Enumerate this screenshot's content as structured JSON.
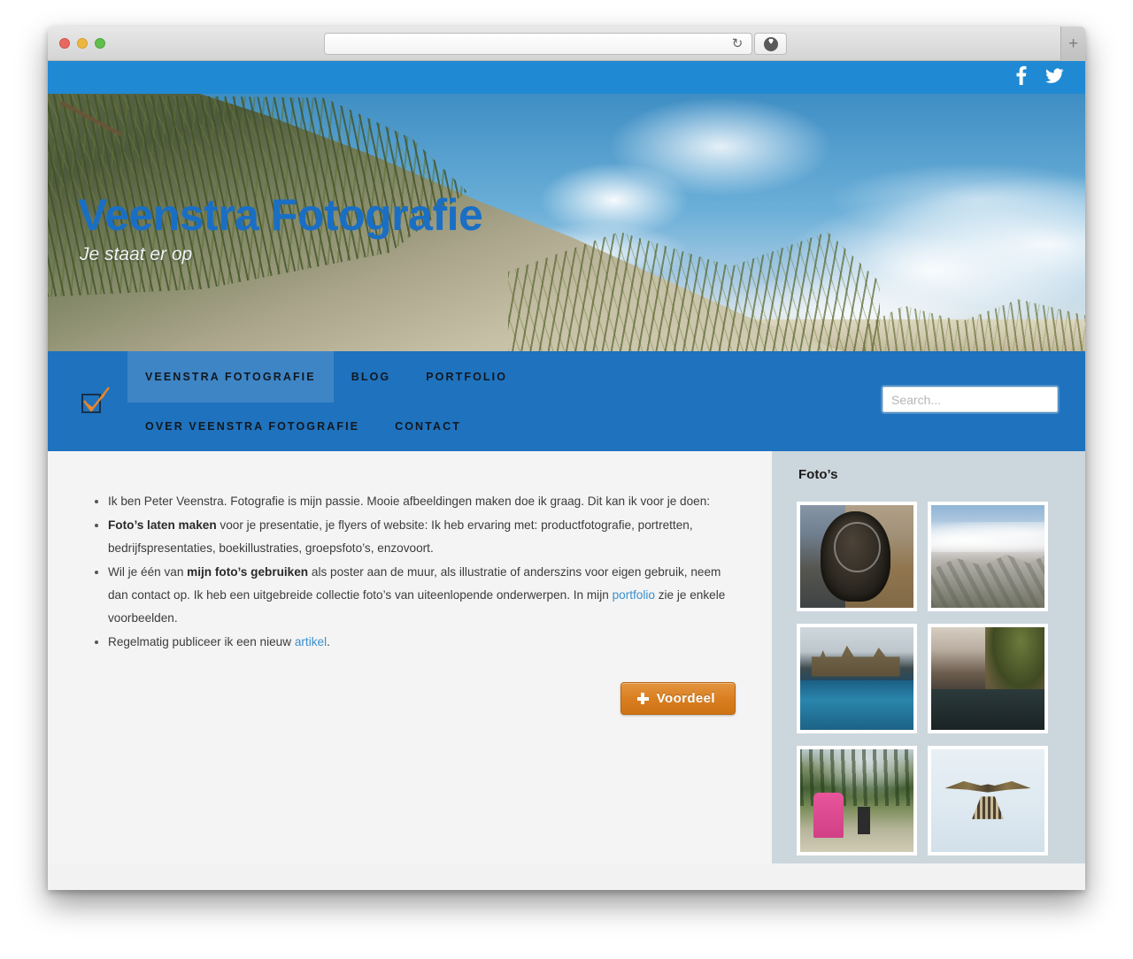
{
  "browser": {
    "url_value": "",
    "url_placeholder": "",
    "reload_icon": "reload-icon",
    "download_icon": "download-icon",
    "newtab_label": "+",
    "traffic_lights": [
      "close",
      "minimize",
      "zoom"
    ]
  },
  "topbar": {
    "social": [
      {
        "name": "facebook-icon",
        "label": "f"
      },
      {
        "name": "twitter-icon",
        "label": "t"
      }
    ],
    "bg_color": "#2089d4"
  },
  "hero": {
    "title": "Veenstra Fotografie",
    "tagline": "Je staat er op",
    "title_color": "#1a6fc4",
    "image_alt": "beach dune with marram grass, sand and cumulus clouds"
  },
  "nav": {
    "logo_name": "orange-checkmark-logo",
    "bg_color": "#1f72bd",
    "row1": [
      {
        "label": "VEENSTRA FOTOGRAFIE",
        "active": true
      },
      {
        "label": "BLOG",
        "active": false
      },
      {
        "label": "PORTFOLIO",
        "active": false
      }
    ],
    "row2": [
      {
        "label": "OVER VEENSTRA FOTOGRAFIE",
        "active": false
      },
      {
        "label": "CONTACT",
        "active": false
      }
    ],
    "search_placeholder": "Search...",
    "search_value": ""
  },
  "main": {
    "items": [
      {
        "parts": [
          {
            "t": "text",
            "v": "Ik ben Peter Veenstra. Fotografie is mijn passie. Mooie afbeeldingen maken doe ik graag. Dit kan ik voor je doen:"
          }
        ]
      },
      {
        "parts": [
          {
            "t": "bold",
            "v": "Foto’s laten maken"
          },
          {
            "t": "text",
            "v": " voor je presentatie, je flyers of website: Ik heb ervaring met: productfotografie, portretten, bedrijfspresentaties, boekillustraties, groepsfoto’s, enzovoort."
          }
        ]
      },
      {
        "parts": [
          {
            "t": "text",
            "v": "Wil je één van "
          },
          {
            "t": "bold",
            "v": "mijn foto’s gebruiken"
          },
          {
            "t": "text",
            "v": " als poster aan de muur, als illustratie of anderszins voor eigen gebruik, neem dan contact op. Ik heb een uitgebreide collectie foto’s van uiteenlopende onderwerpen. In mijn "
          },
          {
            "t": "link",
            "v": "portfolio"
          },
          {
            "t": "text",
            "v": " zie je enkele voorbeelden."
          }
        ]
      },
      {
        "parts": [
          {
            "t": "text",
            "v": "Regelmatig publiceer ik een nieuw "
          },
          {
            "t": "link",
            "v": "artikel"
          },
          {
            "t": "text",
            "v": "."
          }
        ]
      }
    ],
    "share_button": {
      "label": "Voordeel",
      "icon": "plus-icon",
      "color": "#d97f21"
    }
  },
  "sidebar": {
    "title": "Foto’s",
    "bg_color": "#ccd6dd",
    "thumbnails": [
      {
        "name": "thumb-horse-harness",
        "alt": "dark leather horse harness hanging",
        "cls": "t-harness"
      },
      {
        "name": "thumb-mountain-rocks",
        "alt": "rocky mountain slope with clouds",
        "cls": "t-rocks"
      },
      {
        "name": "thumb-koppelpoort",
        "alt": "historic dutch gate over water at dusk",
        "cls": "t-gate"
      },
      {
        "name": "thumb-canal-street",
        "alt": "dutch canal street with church tower",
        "cls": "t-canal"
      },
      {
        "name": "thumb-children-cycling",
        "alt": "children cycling on a mountain path",
        "cls": "t-bikes"
      },
      {
        "name": "thumb-kestrel-flight",
        "alt": "kestrel hovering against pale sky",
        "cls": "t-bird"
      }
    ]
  }
}
